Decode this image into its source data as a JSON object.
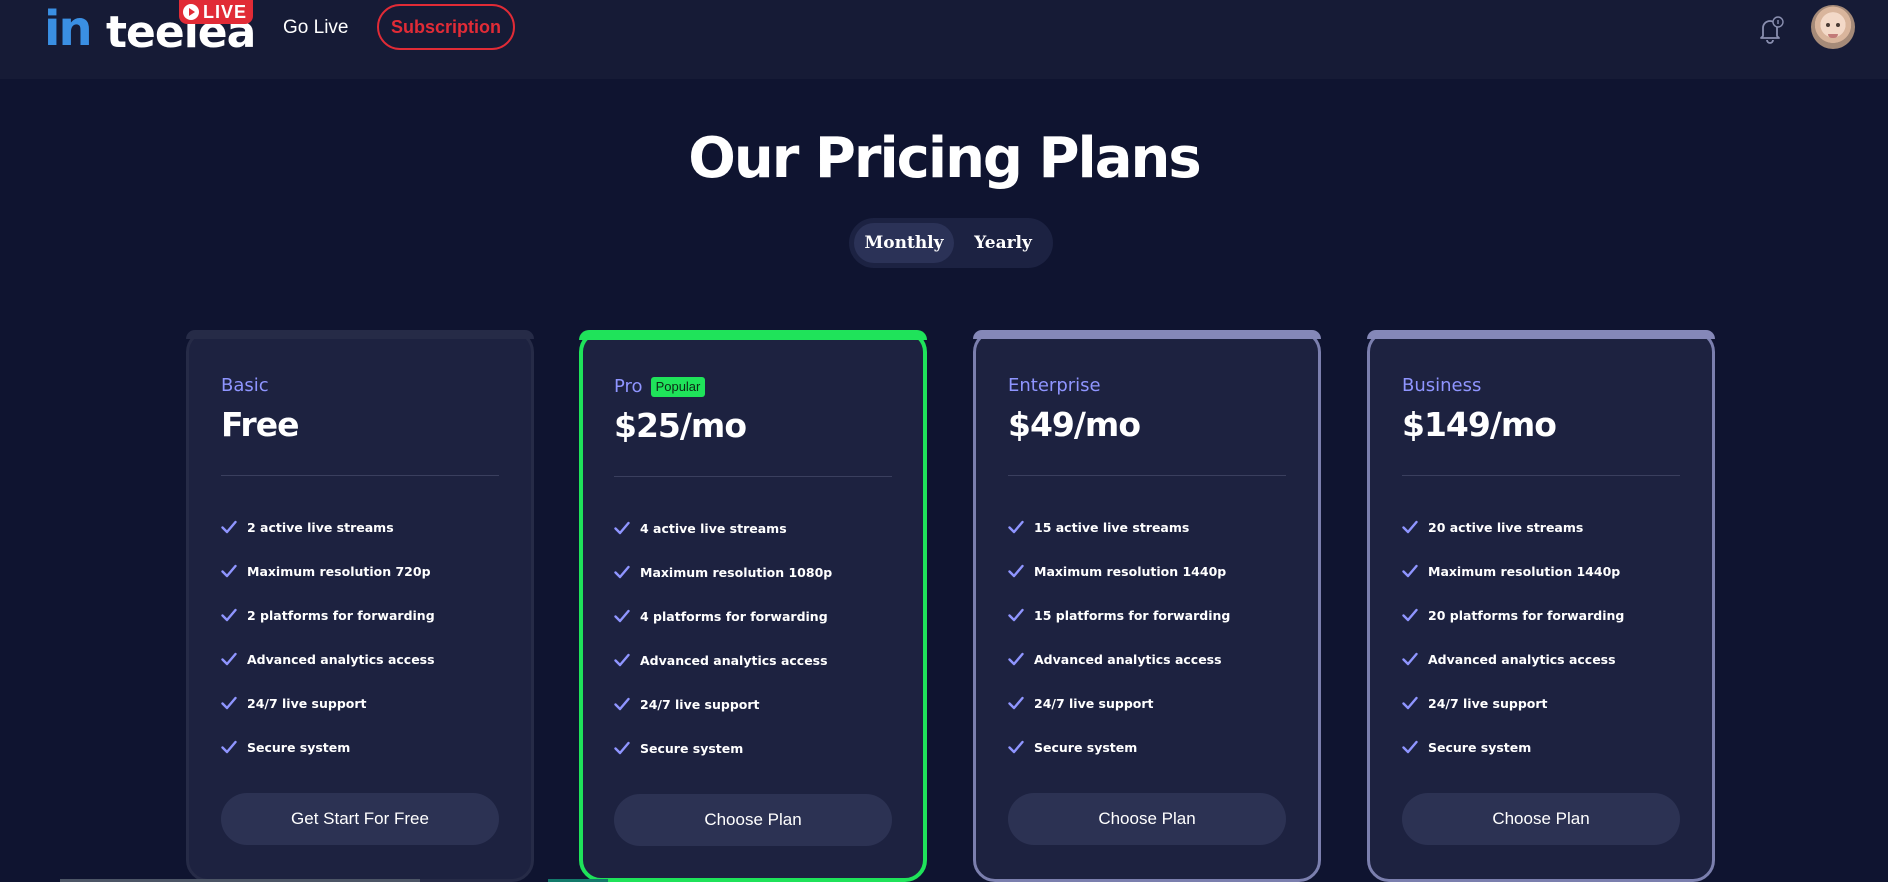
{
  "header": {
    "logo_prefix": "in",
    "logo_text": "teelea",
    "live_badge": "LIVE",
    "nav_golive": "Go Live",
    "nav_subscription": "Subscription",
    "notification_icon": "bell-icon",
    "avatar_icon": "user-avatar"
  },
  "hero": {
    "title": "Our Pricing Plans",
    "billing_options": [
      "Monthly",
      "Yearly"
    ],
    "selected_billing": "Monthly"
  },
  "colors": {
    "background": "#0f1430",
    "card": "#1d2240",
    "accent_green": "#1fe35a",
    "plan_name": "#8f95ff",
    "brand_red": "#e12b36",
    "brand_blue": "#3a8fe3"
  },
  "plans": [
    {
      "name": "Basic",
      "price": "Free",
      "badge": "",
      "features": [
        "2 active live streams",
        "Maximum resolution 720p",
        "2 platforms for forwarding",
        "Advanced analytics access",
        "24/7 live support",
        "Secure system"
      ],
      "button": "Get Start For Free"
    },
    {
      "name": "Pro",
      "price": "$25/mo",
      "badge": "Popular",
      "features": [
        "4 active live streams",
        "Maximum resolution 1080p",
        "4 platforms for forwarding",
        "Advanced analytics access",
        "24/7 live support",
        "Secure system"
      ],
      "button": "Choose Plan"
    },
    {
      "name": "Enterprise",
      "price": "$49/mo",
      "badge": "",
      "features": [
        "15 active live streams",
        "Maximum resolution 1440p",
        "15 platforms for forwarding",
        "Advanced analytics access",
        "24/7 live support",
        "Secure system"
      ],
      "button": "Choose Plan"
    },
    {
      "name": "Business",
      "price": "$149/mo",
      "badge": "",
      "features": [
        "20 active live streams",
        "Maximum resolution 1440p",
        "20 platforms for forwarding",
        "Advanced analytics access",
        "24/7 live support",
        "Secure system"
      ],
      "button": "Choose Plan"
    }
  ]
}
